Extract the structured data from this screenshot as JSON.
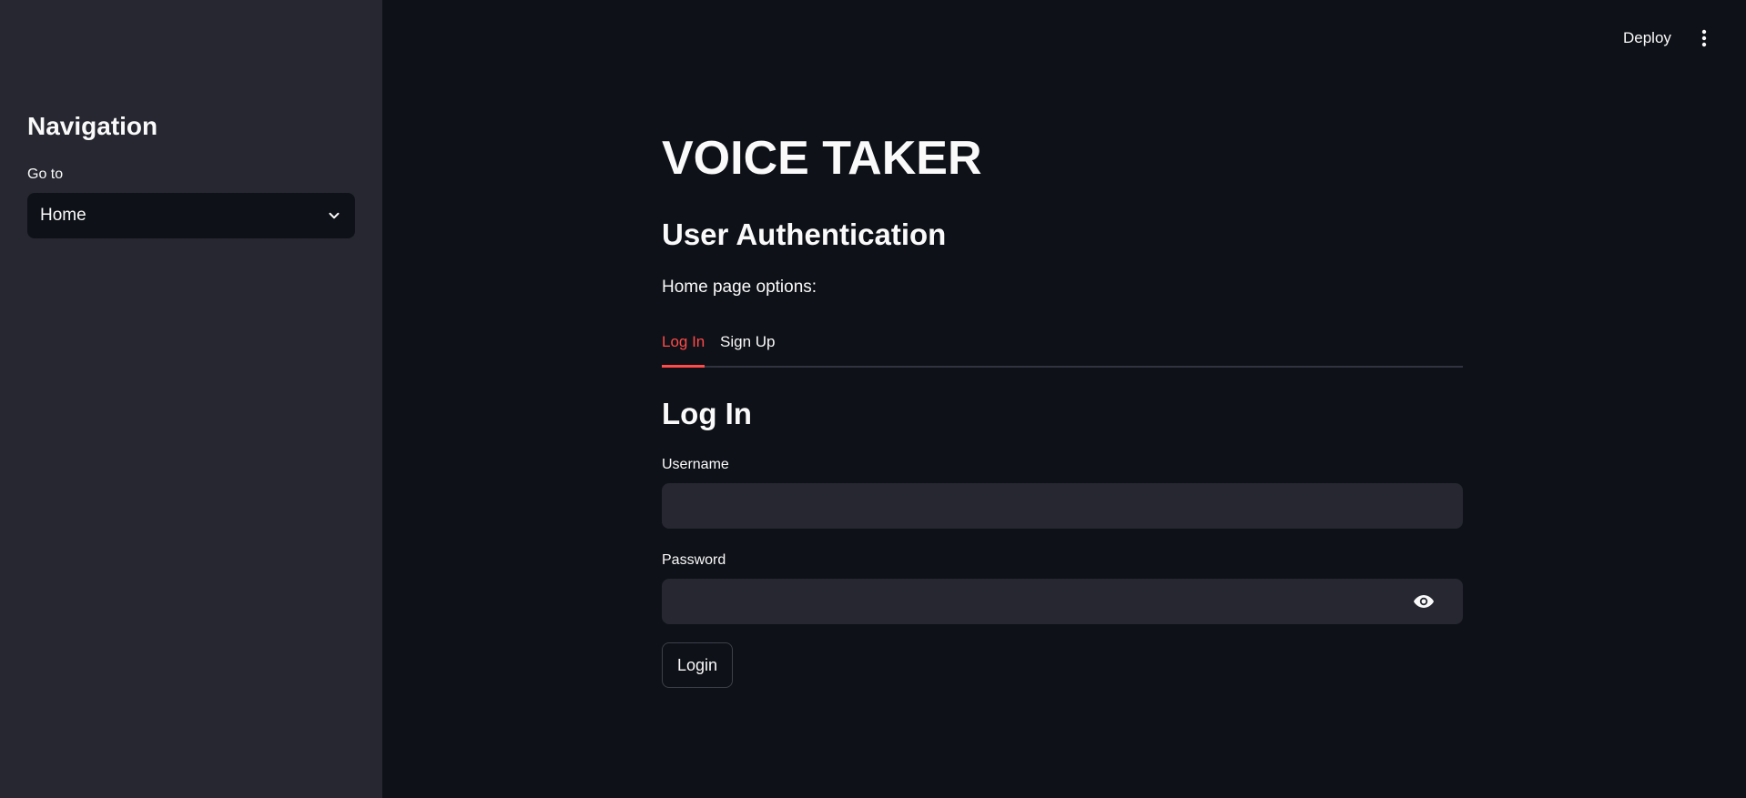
{
  "sidebar": {
    "title": "Navigation",
    "goto_label": "Go to",
    "select_value": "Home"
  },
  "header": {
    "deploy_label": "Deploy"
  },
  "main": {
    "title": "VOICE TAKER",
    "subtitle": "User Authentication",
    "options_label": "Home page options:",
    "tabs": [
      {
        "label": "Log In",
        "active": true
      },
      {
        "label": "Sign Up",
        "active": false
      }
    ],
    "form": {
      "heading": "Log In",
      "username_label": "Username",
      "username_value": "",
      "password_label": "Password",
      "password_value": "",
      "submit_label": "Login"
    }
  },
  "colors": {
    "background": "#0e1117",
    "sidebar": "#262730",
    "accent": "#ff4b4b",
    "text": "#fafafa"
  },
  "icons": {
    "select": "chevron-down-icon",
    "menu": "more-vertical-icon",
    "password_toggle": "eye-icon"
  }
}
